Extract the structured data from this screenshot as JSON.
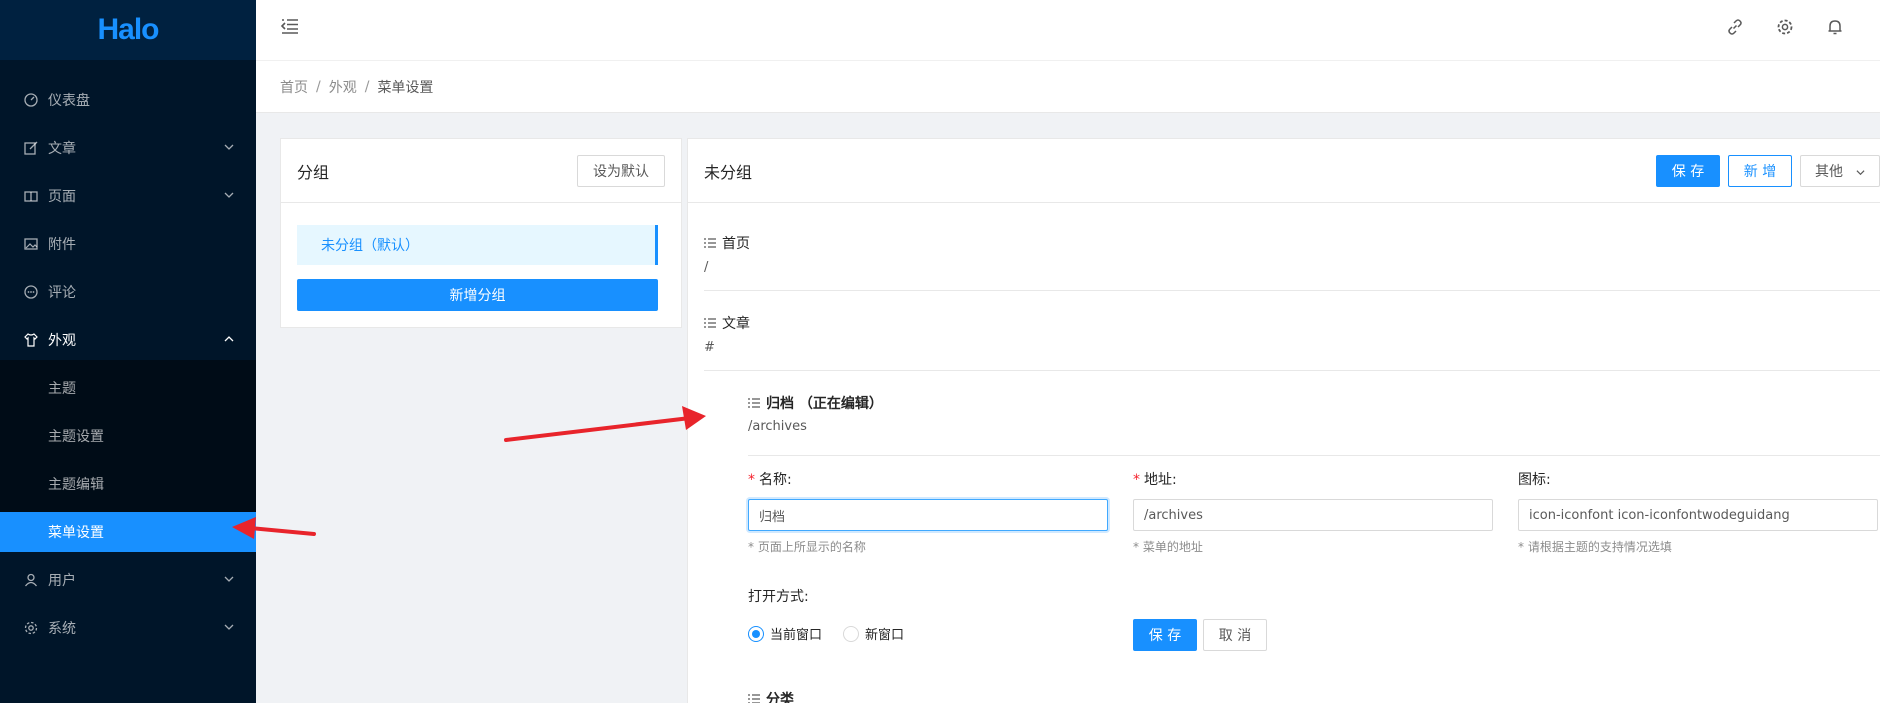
{
  "sidebar": {
    "logo": "Halo",
    "items": [
      {
        "label": "仪表盘",
        "icon": "dashboard-icon"
      },
      {
        "label": "文章",
        "icon": "form-icon"
      },
      {
        "label": "页面",
        "icon": "read-icon"
      },
      {
        "label": "附件",
        "icon": "picture-icon"
      },
      {
        "label": "评论",
        "icon": "message-icon"
      },
      {
        "label": "外观",
        "icon": "skin-icon"
      },
      {
        "label": "用户",
        "icon": "user-icon"
      },
      {
        "label": "系统",
        "icon": "setting-icon"
      }
    ],
    "submenu": [
      {
        "label": "主题"
      },
      {
        "label": "主题设置"
      },
      {
        "label": "主题编辑"
      },
      {
        "label": "菜单设置"
      }
    ]
  },
  "header": {
    "icons": [
      "menu-fold-icon",
      "link-icon",
      "setting-icon",
      "bell-icon"
    ]
  },
  "breadcrumb": [
    "首页",
    "外观",
    "菜单设置"
  ],
  "group_card": {
    "title": "分组",
    "set_default_label": "设为默认",
    "group_item": "未分组（默认）",
    "add_group_label": "新增分组"
  },
  "menu_card": {
    "title": "未分组",
    "save_label": "保 存",
    "add_label": "新 增",
    "more_label": "其他",
    "rows": [
      {
        "title": "首页",
        "url": "/"
      },
      {
        "title": "文章",
        "url": "#"
      },
      {
        "title": "归档 （正在编辑）",
        "url": "/archives"
      },
      {
        "title": "分类",
        "url": ""
      }
    ],
    "form": {
      "name_label": "名称:",
      "name_value": "归档",
      "name_help": "* 页面上所显示的名称",
      "url_label": "地址:",
      "url_value": "/archives",
      "url_help": "* 菜单的地址",
      "icon_label": "图标:",
      "icon_value": "icon-iconfont icon-iconfontwodeguidang",
      "icon_help": "* 请根据主题的支持情况选填",
      "open_label": "打开方式:",
      "option_current": "当前窗口",
      "option_new": "新窗口",
      "save_label": "保 存",
      "cancel_label": "取 消"
    }
  },
  "colors": {
    "primary": "#1890ff",
    "sidebar_bg": "#001529",
    "annotation_arrow": "#e8242b"
  }
}
